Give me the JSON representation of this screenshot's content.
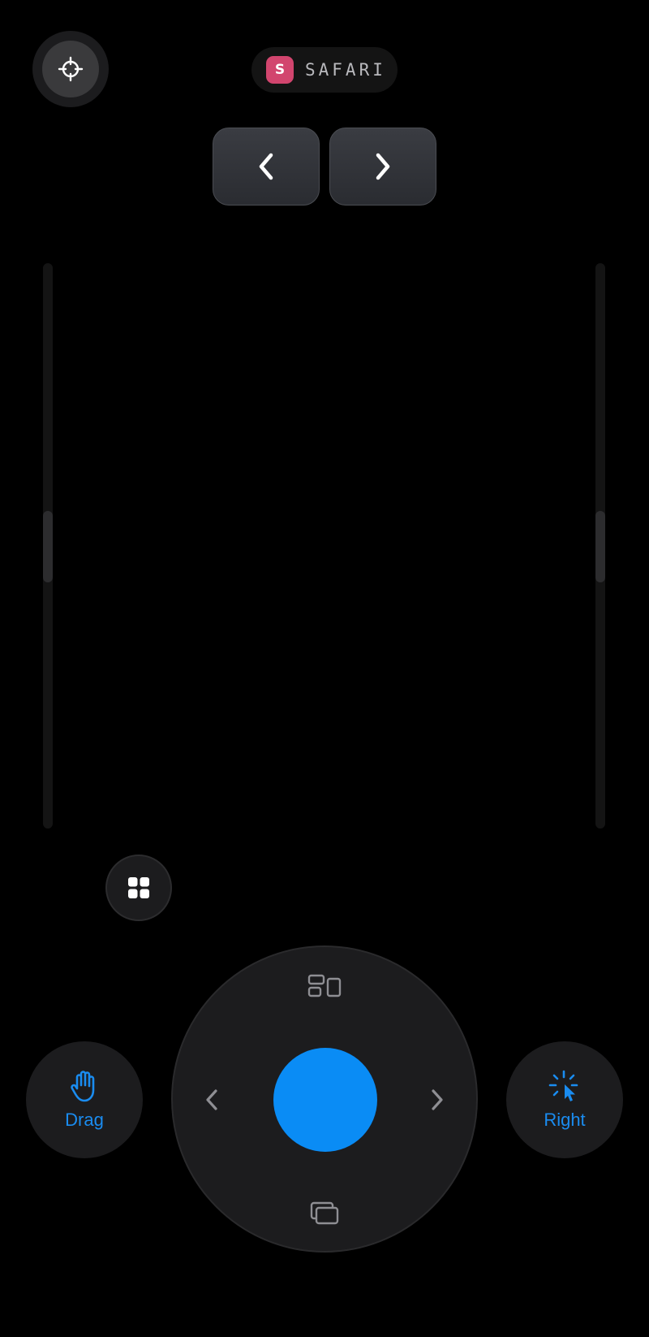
{
  "header": {
    "target_icon": "crosshair-icon",
    "app": {
      "badge_letter": "S",
      "name": "SAFARI",
      "badge_color": "#d2456e"
    }
  },
  "navigation": {
    "back_icon": "chevron-left-icon",
    "forward_icon": "chevron-right-icon"
  },
  "scrollbars": {
    "left_thumb_position": 0.45,
    "right_thumb_position": 0.45
  },
  "apps_button": {
    "icon": "app-grid-icon"
  },
  "dpad": {
    "up_icon": "window-layout-icon",
    "down_icon": "window-stack-icon",
    "left_icon": "chevron-left-icon",
    "right_icon": "chevron-right-icon",
    "center_color": "#0a8cf5"
  },
  "actions": {
    "drag": {
      "label": "Drag",
      "icon": "hand-icon"
    },
    "right_click": {
      "label": "Right",
      "icon": "cursor-click-icon"
    },
    "accent_color": "#1a8cf0"
  }
}
